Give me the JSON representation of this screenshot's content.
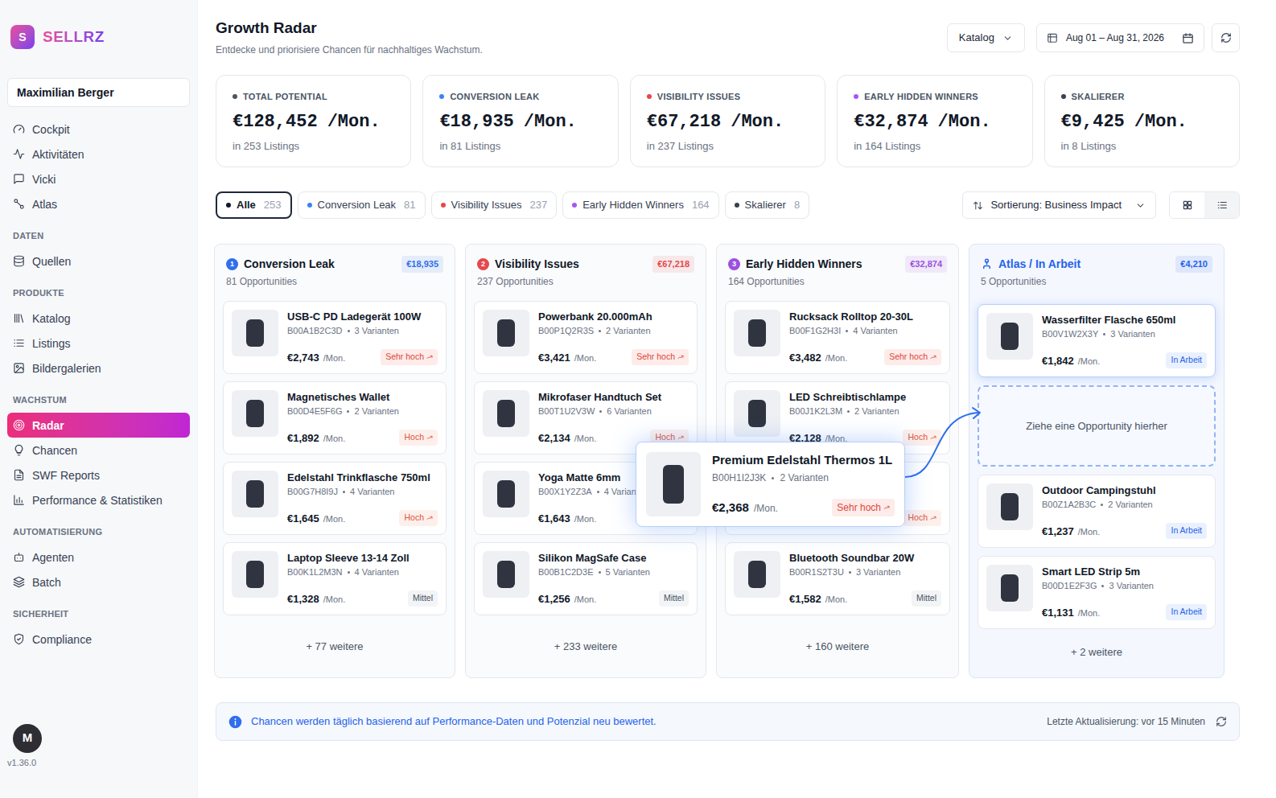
{
  "brand": {
    "logo": "S",
    "name": "SELLRZ"
  },
  "user": {
    "name": "Maximilian Berger"
  },
  "sidebar": {
    "sections": [
      {
        "heading": "",
        "items": [
          {
            "label": "Cockpit",
            "selected": false
          },
          {
            "label": "Aktivitäten",
            "selected": false
          },
          {
            "label": "Vicki",
            "selected": false
          },
          {
            "label": "Atlas",
            "selected": false
          }
        ]
      },
      {
        "heading": "DATEN",
        "items": [
          {
            "label": "Quellen",
            "selected": false
          }
        ]
      },
      {
        "heading": "PRODUKTE",
        "items": [
          {
            "label": "Katalog",
            "selected": false
          },
          {
            "label": "Listings",
            "selected": false
          },
          {
            "label": "Bildergalerien",
            "selected": false
          }
        ]
      },
      {
        "heading": "WACHSTUM",
        "items": [
          {
            "label": "Radar",
            "selected": true
          },
          {
            "label": "Chancen",
            "selected": false
          },
          {
            "label": "SWF Reports",
            "selected": false
          },
          {
            "label": "Performance & Statistiken",
            "selected": false
          }
        ]
      },
      {
        "heading": "AUTOMATISIERUNG",
        "items": [
          {
            "label": "Agenten",
            "selected": false
          },
          {
            "label": "Batch",
            "selected": false
          }
        ]
      },
      {
        "heading": "SICHERHEIT",
        "items": [
          {
            "label": "Compliance",
            "selected": false
          }
        ]
      }
    ]
  },
  "account": {
    "avatar": "M",
    "version": "v1.36.0"
  },
  "header": {
    "title": "Growth Radar",
    "subtitle": "Entdecke und priorisiere Chancen für nachhaltiges Wachstum.",
    "catalog": "Katalog",
    "date": "Aug 01 – Aug 31, 2026"
  },
  "kpis": [
    {
      "label": "TOTAL POTENTIAL",
      "value": "€128,452",
      "unit": "/Mon.",
      "sub": "in 253 Listings",
      "color": "#4b5563"
    },
    {
      "label": "CONVERSION LEAK",
      "value": "€18,935",
      "unit": "/Mon.",
      "sub": "in 81 Listings",
      "color": "#3b82f6"
    },
    {
      "label": "VISIBILITY ISSUES",
      "value": "€67,218",
      "unit": "/Mon.",
      "sub": "in 237 Listings",
      "color": "#ef4444"
    },
    {
      "label": "EARLY HIDDEN WINNERS",
      "value": "€32,874",
      "unit": "/Mon.",
      "sub": "in 164 Listings",
      "color": "#a855f7"
    },
    {
      "label": "SKALIERER",
      "value": "€9,425",
      "unit": "/Mon.",
      "sub": "in 8 Listings",
      "color": "#374151"
    }
  ],
  "filters": [
    {
      "label": "Alle",
      "count": "253",
      "selected": true,
      "color": "#111827"
    },
    {
      "label": "Conversion Leak",
      "count": "81",
      "selected": false,
      "color": "#3b82f6"
    },
    {
      "label": "Visibility Issues",
      "count": "237",
      "selected": false,
      "color": "#ef4444"
    },
    {
      "label": "Early Hidden Winners",
      "count": "164",
      "selected": false,
      "color": "#a855f7"
    },
    {
      "label": "Skalierer",
      "count": "8",
      "selected": false,
      "color": "#374151"
    }
  ],
  "sort": {
    "label": "Sortierung: Business Impact"
  },
  "views": [
    {
      "kind": "grid",
      "selected": false
    },
    {
      "kind": "list",
      "selected": true
    }
  ],
  "columns": [
    {
      "kind": "category",
      "number": "1",
      "title": "Conversion Leak",
      "amount": "€18,935",
      "sub": "81 Opportunities",
      "color": "#2f6fed",
      "more": "+ 77 weitere",
      "cards": [
        {
          "kind": "card",
          "name": "USB-C PD Ladegerät 100W",
          "asin": "B00A1B2C3D",
          "variants": "3 Varianten",
          "price": "€2,743",
          "unit": "/Mon.",
          "badge": "Sehr hoch",
          "level": "sehr-hoch"
        },
        {
          "kind": "card",
          "name": "Magnetisches Wallet",
          "asin": "B00D4E5F6G",
          "variants": "2 Varianten",
          "price": "€1,892",
          "unit": "/Mon.",
          "badge": "Hoch",
          "level": "hoch"
        },
        {
          "kind": "card",
          "name": "Edelstahl Trinkflasche 750ml",
          "asin": "B00G7H8I9J",
          "variants": "4 Varianten",
          "price": "€1,645",
          "unit": "/Mon.",
          "badge": "Hoch",
          "level": "hoch"
        },
        {
          "kind": "card",
          "name": "Laptop Sleeve 13-14 Zoll",
          "asin": "B00K1L2M3N",
          "variants": "4 Varianten",
          "price": "€1,328",
          "unit": "/Mon.",
          "badge": "Mittel",
          "level": "mittel"
        }
      ]
    },
    {
      "kind": "category",
      "number": "2",
      "title": "Visibility Issues",
      "amount": "€67,218",
      "sub": "237 Opportunities",
      "color": "#e5484d",
      "more": "+ 233 weitere",
      "cards": [
        {
          "kind": "card",
          "name": "Powerbank 20.000mAh",
          "asin": "B00P1Q2R3S",
          "variants": "2 Varianten",
          "price": "€3,421",
          "unit": "/Mon.",
          "badge": "Sehr hoch",
          "level": "sehr-hoch"
        },
        {
          "kind": "card",
          "name": "Mikrofaser Handtuch Set",
          "asin": "B00T1U2V3W",
          "variants": "6 Varianten",
          "price": "€2,134",
          "unit": "/Mon.",
          "badge": "Hoch",
          "level": "hoch"
        },
        {
          "kind": "card",
          "name": "Yoga Matte 6mm",
          "asin": "B00X1Y2Z3A",
          "variants": "4 Varian",
          "price": "€1,643",
          "unit": "/Mon."
        },
        {
          "kind": "card",
          "name": "Silikon MagSafe Case",
          "asin": "B00B1C2D3E",
          "variants": "5 Varianten",
          "price": "€1,256",
          "unit": "/Mon.",
          "badge": "Mittel",
          "level": "mittel"
        }
      ]
    },
    {
      "kind": "category",
      "number": "3",
      "title": "Early Hidden Winners",
      "amount": "€32,874",
      "sub": "164 Opportunities",
      "color": "#9b51e0",
      "more": "+ 160 weitere",
      "cards": [
        {
          "kind": "card",
          "name": "Rucksack Rolltop 20-30L",
          "asin": "B00F1G2H3I",
          "variants": "4 Varianten",
          "price": "€3,482",
          "unit": "/Mon.",
          "badge": "Sehr hoch",
          "level": "sehr-hoch"
        },
        {
          "kind": "card",
          "name": "LED Schreibtischlampe",
          "asin": "B00J1K2L3M",
          "variants": "2 Varianten",
          "price": "€2,128",
          "unit": "/Mon.",
          "badge": "Hoch",
          "level": "hoch"
        },
        {
          "kind": "covered",
          "badge": "Hoch",
          "level": "hoch"
        },
        {
          "kind": "card",
          "name": "Bluetooth Soundbar 20W",
          "asin": "B00R1S2T3U",
          "variants": "3 Varianten",
          "price": "€1,582",
          "unit": "/Mon.",
          "badge": "Mittel",
          "level": "mittel"
        }
      ]
    },
    {
      "kind": "atlas",
      "title": "Atlas / In Arbeit",
      "amount": "€4,210",
      "sub": "5 Opportunities",
      "color": "#2563eb",
      "more": "+ 2 weitere",
      "cards": [
        {
          "kind": "card",
          "highlighted": true,
          "name": "Wasserfilter Flasche 650ml",
          "asin": "B00V1W2X3Y",
          "variants": "3 Varianten",
          "price": "€1,842",
          "unit": "/Mon.",
          "badge": "In Arbeit",
          "level": "in-arbeit"
        },
        {
          "kind": "dropzone",
          "text": "Ziehe eine Opportunity hierher"
        },
        {
          "kind": "card",
          "highlighted": false,
          "name": "Outdoor Campingstuhl",
          "asin": "B00Z1A2B3C",
          "variants": "2 Varianten",
          "price": "€1,237",
          "unit": "/Mon.",
          "badge": "In Arbeit",
          "level": "in-arbeit"
        },
        {
          "kind": "card",
          "highlighted": false,
          "name": "Smart LED Strip 5m",
          "asin": "B00D1E2F3G",
          "variants": "3 Varianten",
          "price": "€1,131",
          "unit": "/Mon.",
          "badge": "In Arbeit",
          "level": "in-arbeit"
        }
      ]
    }
  ],
  "drag": {
    "name": "Premium Edelstahl Thermos 1L",
    "asin": "B00H1I2J3K",
    "variants": "2 Varianten",
    "price": "€2,368",
    "unit": "/Mon.",
    "badge": "Sehr hoch",
    "level": "sehr-hoch"
  },
  "info": {
    "text": "Chancen werden täglich basierend auf Performance-Daten und Potenzial neu bewertet.",
    "updated": "Letzte Aktualisierung: vor 15 Minuten"
  }
}
